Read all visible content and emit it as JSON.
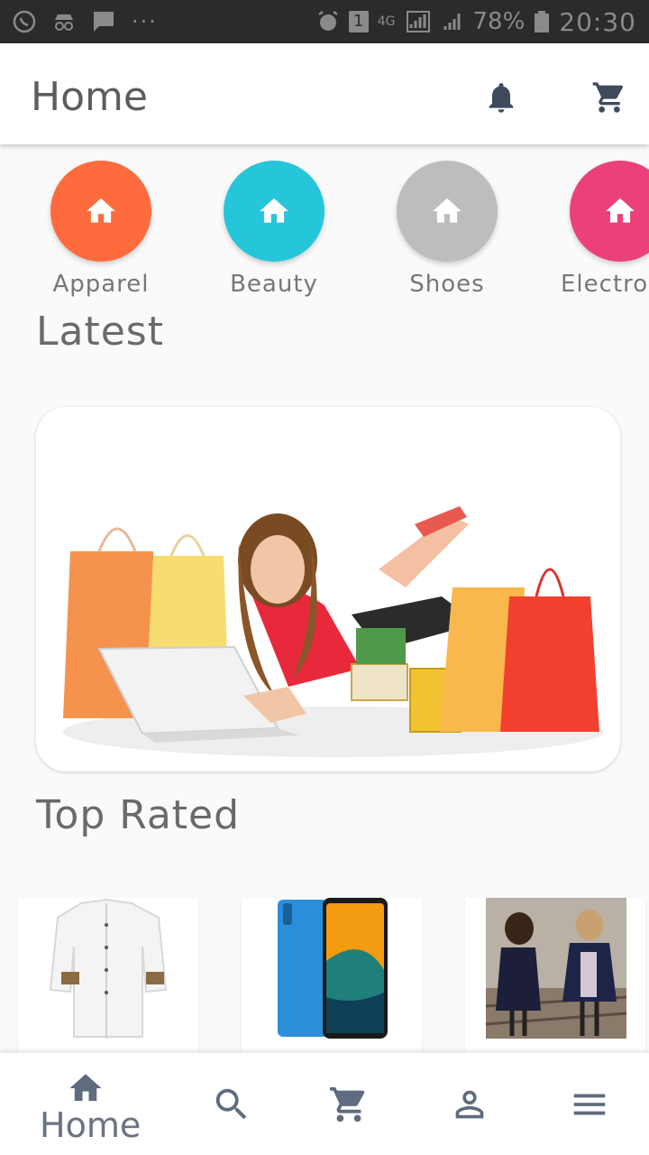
{
  "status_bar": {
    "battery": "78%",
    "time": "20:30",
    "network": "4G",
    "sim_badge": "1",
    "dots": "···"
  },
  "app_bar": {
    "title": "Home",
    "icons": [
      "bell-icon",
      "cart-icon"
    ]
  },
  "categories": [
    {
      "label": "Apparel",
      "color": "#ff6b3d",
      "icon": "home-icon"
    },
    {
      "label": "Beauty",
      "color": "#26c6da",
      "icon": "home-icon"
    },
    {
      "label": "Shoes",
      "color": "#bdbdbd",
      "icon": "home-icon"
    },
    {
      "label": "Electronics",
      "color": "#ec407a",
      "icon": "home-icon"
    }
  ],
  "latest": {
    "title": "Latest"
  },
  "top_rated": {
    "title": "Top Rated",
    "items": [
      "white-shirt-image",
      "smartphone-image",
      "girls-coats-image"
    ]
  },
  "bottom_nav": {
    "home_label": "Home",
    "icons": [
      "home-icon",
      "search-icon",
      "cart-icon",
      "person-icon",
      "menu-icon"
    ],
    "icon_color": "#5f6b7e"
  }
}
